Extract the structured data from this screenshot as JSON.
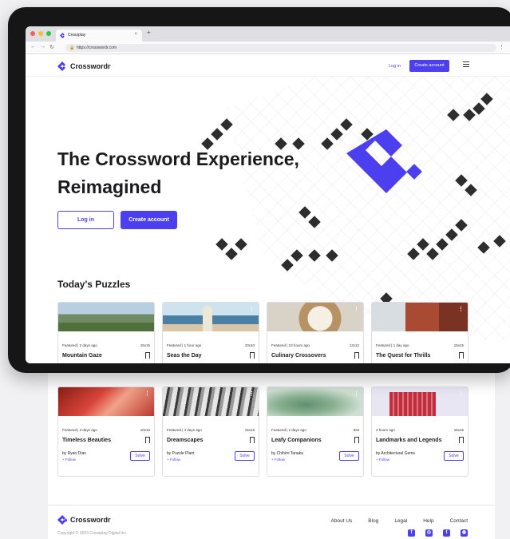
{
  "browser": {
    "tab_title": "Crossplay",
    "url": "https://crosswordr.com",
    "new_tab": "+",
    "close": "×"
  },
  "site": {
    "brand": "Crosswordr",
    "login": "Log in",
    "create": "Create account"
  },
  "hero": {
    "line1": "The Crossword Experience,",
    "line2": "Reimagined",
    "login_button": "Log in",
    "create_button": "Create account"
  },
  "section_title": "Today's Puzzles",
  "colors": {
    "accent": "#4c3ff0",
    "tile": "#2d2d2d"
  },
  "cards_row1": [
    {
      "meta": "Featured | 2 days ago",
      "size": "15x15",
      "title": "Mountain Gaze"
    },
    {
      "meta": "Featured | 1 hour ago",
      "size": "10x10",
      "title": "Seas the Day"
    },
    {
      "meta": "Featured | 13 hours ago",
      "size": "12x12",
      "title": "Culinary Crossovers"
    },
    {
      "meta": "Featured | 1 day ago",
      "size": "15x15",
      "title": "The Quest for Thrills"
    }
  ],
  "cards_row2": [
    {
      "meta": "Featured | 2 days ago",
      "size": "10x10",
      "title": "Timeless Beauties",
      "by": "by Ryan Dias",
      "follow": "+ Follow",
      "solve": "Solve"
    },
    {
      "meta": "Featured | 4 days ago",
      "size": "15x15",
      "title": "Dreamscapes",
      "by": "by Puzzle Plant",
      "follow": "+ Follow",
      "solve": "Solve"
    },
    {
      "meta": "Featured | 2 days ago",
      "size": "8x8",
      "title": "Leafy Companions",
      "by": "by Chihiro Tanaka",
      "follow": "+ Follow",
      "solve": "Solve"
    },
    {
      "meta": "3 hours ago",
      "size": "15x15",
      "title": "Landmarks and Legends",
      "by": "by Architectural Gems",
      "follow": "+ Follow",
      "solve": "Solve"
    }
  ],
  "footer": {
    "brand": "Crosswordr",
    "copyright": "Copyright © 2023 Crossplay Digital Inc.",
    "links": [
      "About Us",
      "Blog",
      "Legal",
      "Help",
      "Contact"
    ],
    "socials": [
      "facebook-icon",
      "instagram-icon",
      "twitter-icon",
      "discord-icon"
    ]
  }
}
